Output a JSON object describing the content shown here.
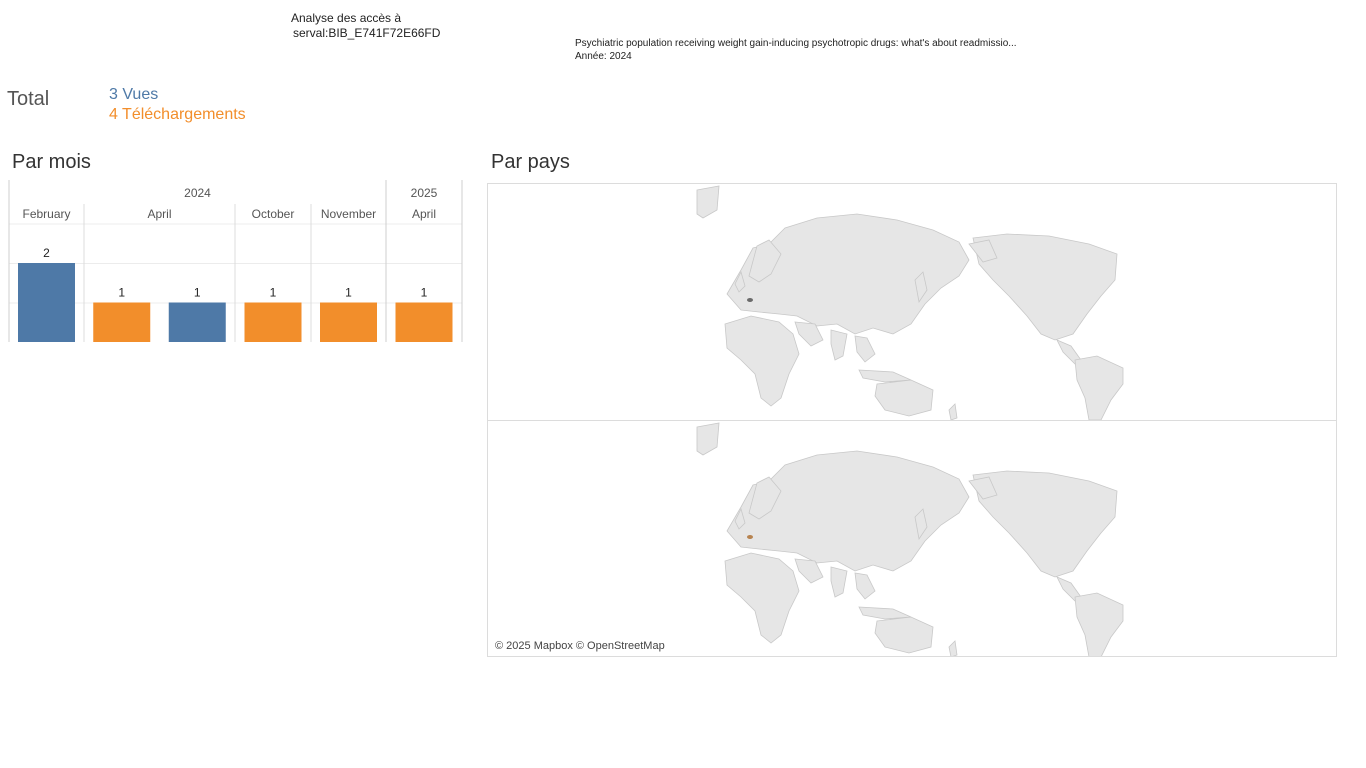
{
  "header": {
    "title_line1": "Analyse des accès à",
    "title_line2": "serval:BIB_E741F72E66FD",
    "publication": "Psychiatric population receiving weight gain-inducing psychotropic drugs: what's about readmissio...",
    "year_line": "Année: 2024"
  },
  "totals": {
    "label": "Total",
    "views": "3 Vues",
    "downloads": "4 Téléchargements"
  },
  "sections": {
    "by_month": "Par mois",
    "by_country": "Par pays"
  },
  "colors": {
    "views": "#4e79a7",
    "downloads": "#f28e2b",
    "land": "#e6e6e6",
    "borders": "#c8c8c8"
  },
  "chart_data": {
    "type": "bar",
    "year_groups": [
      {
        "year": "2024",
        "months": [
          "February",
          "April",
          "October",
          "November"
        ]
      },
      {
        "year": "2025",
        "months": [
          "April"
        ]
      }
    ],
    "months": [
      "February",
      "April",
      "October",
      "November",
      "April"
    ],
    "bars": [
      {
        "month_index": 0,
        "series": "Vues",
        "value": 2
      },
      {
        "month_index": 1,
        "series": "Téléchargements",
        "value": 1
      },
      {
        "month_index": 1,
        "series": "Vues",
        "value": 1
      },
      {
        "month_index": 2,
        "series": "Téléchargements",
        "value": 1
      },
      {
        "month_index": 3,
        "series": "Téléchargements",
        "value": 1
      },
      {
        "month_index": 4,
        "series": "Téléchargements",
        "value": 1
      }
    ],
    "ylim": [
      0,
      2
    ],
    "grid": true
  },
  "map": {
    "attribution": "© 2025 Mapbox © OpenStreetMap",
    "panels": [
      {
        "series": "Vues",
        "highlight_color": "#6b6b6b"
      },
      {
        "series": "Téléchargements",
        "highlight_color": "#b7834f"
      }
    ]
  }
}
